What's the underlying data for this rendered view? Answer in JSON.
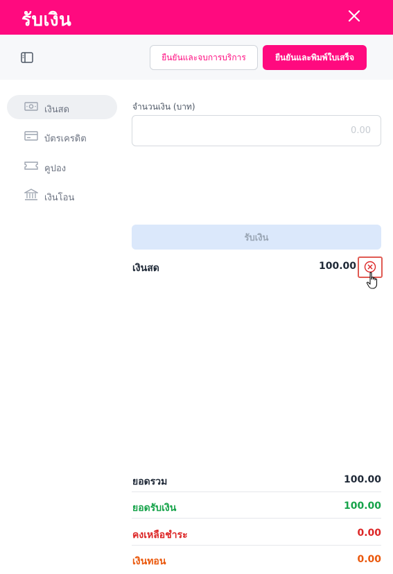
{
  "header": {
    "title": "รับเงิน"
  },
  "toolbar": {
    "confirm_close_label": "ยืนยันและจบการบริการ",
    "confirm_print_label": "ยืนยันและพิมพ์ใบเสร็จ"
  },
  "sidebar": {
    "items": [
      {
        "label": "เงินสด",
        "icon": "cash-icon",
        "active": true
      },
      {
        "label": "บัตรเครดิต",
        "icon": "credit-card-icon",
        "active": false
      },
      {
        "label": "คูปอง",
        "icon": "coupon-icon",
        "active": false
      },
      {
        "label": "เงินโอน",
        "icon": "bank-icon",
        "active": false
      }
    ]
  },
  "form": {
    "amount_label": "จำนวนเงิน (บาท)",
    "amount_placeholder": "0.00",
    "amount_value": "",
    "receive_button": "รับเงิน"
  },
  "payments": [
    {
      "method": "เงินสด",
      "amount": "100.00"
    }
  ],
  "summary": [
    {
      "label": "ยอดรวม",
      "value": "100.00",
      "color": "#1f2937"
    },
    {
      "label": "ยอดรับเงิน",
      "value": "100.00",
      "color": "#16a34a"
    },
    {
      "label": "คงเหลือชำระ",
      "value": "0.00",
      "color": "#dc2626"
    },
    {
      "label": "เงินทอน",
      "value": "0.00",
      "color": "#ea580c"
    }
  ],
  "colors": {
    "brand": "#ff0a7f",
    "disabled_button": "#dbe8fb",
    "remove_outline": "#e05a52"
  }
}
